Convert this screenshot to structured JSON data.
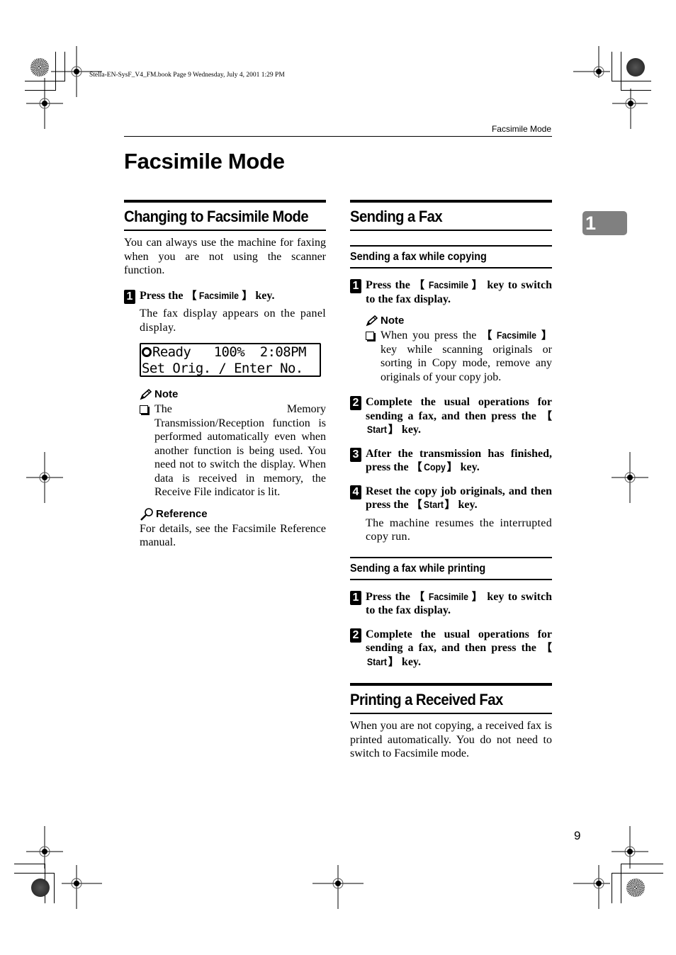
{
  "file_info": "Stella-EN-SysF_V4_FM.book  Page 9  Wednesday, July 4, 2001  1:29 PM",
  "running_head": "Facsimile Mode",
  "page_title": "Facsimile Mode",
  "chapter_tab": "1",
  "page_number": "9",
  "left": {
    "heading": "Changing to Facsimile Mode",
    "intro": "You can always use the machine for faxing when you are not using the scanner function.",
    "step1": {
      "number": "1",
      "pre": "Press the ",
      "key": "Facsimile",
      "post": " key.",
      "desc": "The fax display appears on the panel display."
    },
    "lcd": {
      "line1": "Ready   100%  2:08PM",
      "line2": "Set Orig. / Enter No."
    },
    "note": {
      "label": "Note",
      "item": "The Memory Transmission/Reception function is performed automatically even when another function is being used. You need not to switch the display. When data is received in memory, the Receive File indicator is lit."
    },
    "reference": {
      "label": "Reference",
      "text": "For details, see the Facsimile Reference manual."
    }
  },
  "right": {
    "heading": "Sending a Fax",
    "sub1": {
      "heading": "Sending a fax while copying",
      "step1": {
        "number": "1",
        "pre": "Press the ",
        "key": "Facsimile",
        "post": " key to switch to the fax display."
      },
      "note": {
        "label": "Note",
        "pre": "When you press the ",
        "key": "Facsimile",
        "post": " key while scanning originals or sorting in Copy mode, remove any originals of your copy job."
      },
      "step2": {
        "number": "2",
        "pre": "Complete the usual operations for sending a fax, and then press the ",
        "key": "Start",
        "post": " key."
      },
      "step3": {
        "number": "3",
        "pre": "After the transmission has finished, press the ",
        "key": "Copy",
        "post": " key."
      },
      "step4": {
        "number": "4",
        "pre": "Reset the copy job originals, and then press the ",
        "key": "Start",
        "post": " key.",
        "desc": "The machine resumes the interrupted copy run."
      }
    },
    "sub2": {
      "heading": "Sending a fax while printing",
      "step1": {
        "number": "1",
        "pre": "Press the ",
        "key": "Facsimile",
        "post": " key to switch to the fax display."
      },
      "step2": {
        "number": "2",
        "pre": "Complete the usual operations for sending a fax, and then press the ",
        "key": "Start",
        "post": " key."
      }
    },
    "printing": {
      "heading": "Printing a Received Fax",
      "text": "When you are not copying, a received fax is printed automatically. You do not need to switch to Facsimile mode."
    }
  },
  "brackets": {
    "open": "【",
    "close": "】"
  }
}
